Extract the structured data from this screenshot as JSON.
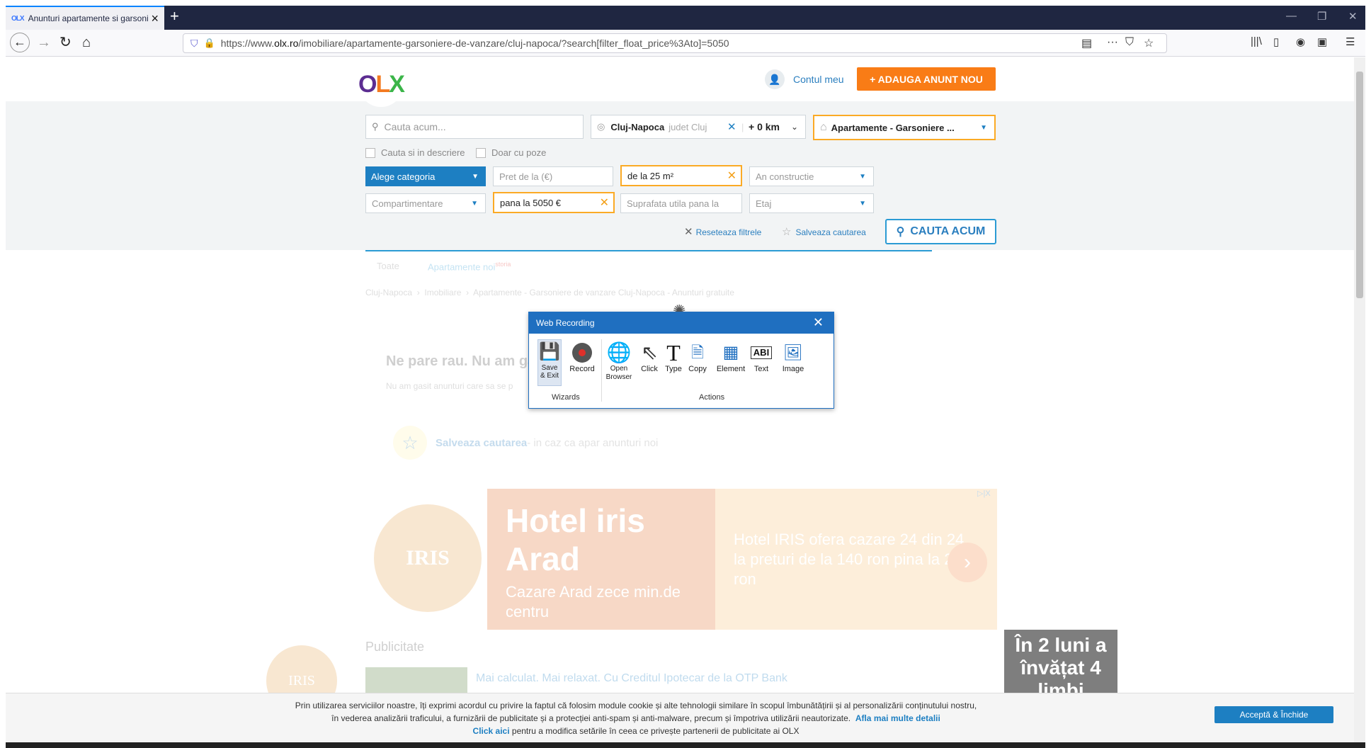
{
  "browser": {
    "tab_title": "Anunturi apartamente si garsoniere...",
    "tab_favicon": "OLX",
    "url_prefix": "https://www.",
    "url_domain": "olx.ro",
    "url_path": "/imobiliare/apartamente-garsoniere-de-vanzare/cluj-napoca/?search[filter_float_price%3Ato]=5050"
  },
  "header": {
    "logo_o": "O",
    "logo_l": "L",
    "logo_x": "X",
    "account_label": "Contul meu",
    "add_button": "+ ADAUGA ANUNT NOU"
  },
  "search": {
    "query_placeholder": "Cauta acum...",
    "location_city": "Cluj-Napoca",
    "location_county": "judet Cluj",
    "radius": "+ 0 km",
    "category": "Apartamente - Garsoniere ...",
    "check_description": "Cauta si in descriere",
    "check_photos": "Doar cu poze",
    "subcategory": "Alege categoria",
    "price_from_placeholder": "Pret de la (€)",
    "area_from": "de la 25 m²",
    "year_built_placeholder": "An constructie",
    "compartments_placeholder": "Compartimentare",
    "price_to": "pana la 5050 €",
    "area_to_placeholder": "Suprafata utila pana la",
    "floor_placeholder": "Etaj",
    "reset_label": "Reseteaza filtrele",
    "save_label": "Salveaza cautarea",
    "search_button": "CAUTA ACUM"
  },
  "results": {
    "tab_all": "Toate",
    "tab_new": "Apartamente noi",
    "tab_new_badge": "storia",
    "breadcrumb_1": "Cluj-Napoca",
    "breadcrumb_2": "Imobiliare",
    "breadcrumb_3": "Apartamente - Garsoniere de vanzare Cluj-Napoca - Anunturi gratuite",
    "empty_title": "Ne pare rau. Nu am găsit",
    "empty_text": "Nu am gasit anunturi care sa se p",
    "save_search_link": "Salveaza cautarea",
    "save_search_text": " - in caz ca apar anunturi noi"
  },
  "ad": {
    "headline": "Hotel iris Arad",
    "sub": "Cazare Arad zece min.de centru",
    "desc": "Hotel IRIS ofera cazare 24 din 24 la preturi de la 140 ron pina la 240 ron",
    "seal_text": "IRIS",
    "tag": "▷|X",
    "publicitate": "Publicitate",
    "otp_link": "Mai calculat. Mai relaxat. Cu Creditul Ipotecar de la OTP Bank",
    "side_ad": "În 2 luni a învățat 4 limbi"
  },
  "cookie": {
    "line1": "Prin utilizarea serviciilor noastre, îți exprimi acordul cu privire la faptul că folosim module cookie și alte tehnologii similare în scopul îmbunătățirii și al personalizării conținutului nostru,",
    "line2": "în vederea analizării traficului, a furnizării de publicitate și a protecției anti-spam și anti-malware, precum și împotriva utilizării neautorizate.",
    "more_link": "Afla mai multe detalii",
    "click_link": "Click aici",
    "line3": "pentru a modifica setările în ceea ce privește partenerii de publicitate ai OLX",
    "accept": "Acceptă & Închide"
  },
  "web_recording": {
    "title": "Web Recording",
    "save_exit": "Save & Exit",
    "record": "Record",
    "open_browser": "Open Browser",
    "click": "Click",
    "type": "Type",
    "copy": "Copy",
    "element": "Element",
    "text": "Text",
    "image": "Image",
    "group_wizards": "Wizards",
    "group_actions": "Actions"
  },
  "colors": {
    "olx_orange": "#f97c16",
    "olx_blue": "#1d7fc2",
    "highlight": "#fbaa25",
    "recorder_blue": "#1f6fc0"
  }
}
